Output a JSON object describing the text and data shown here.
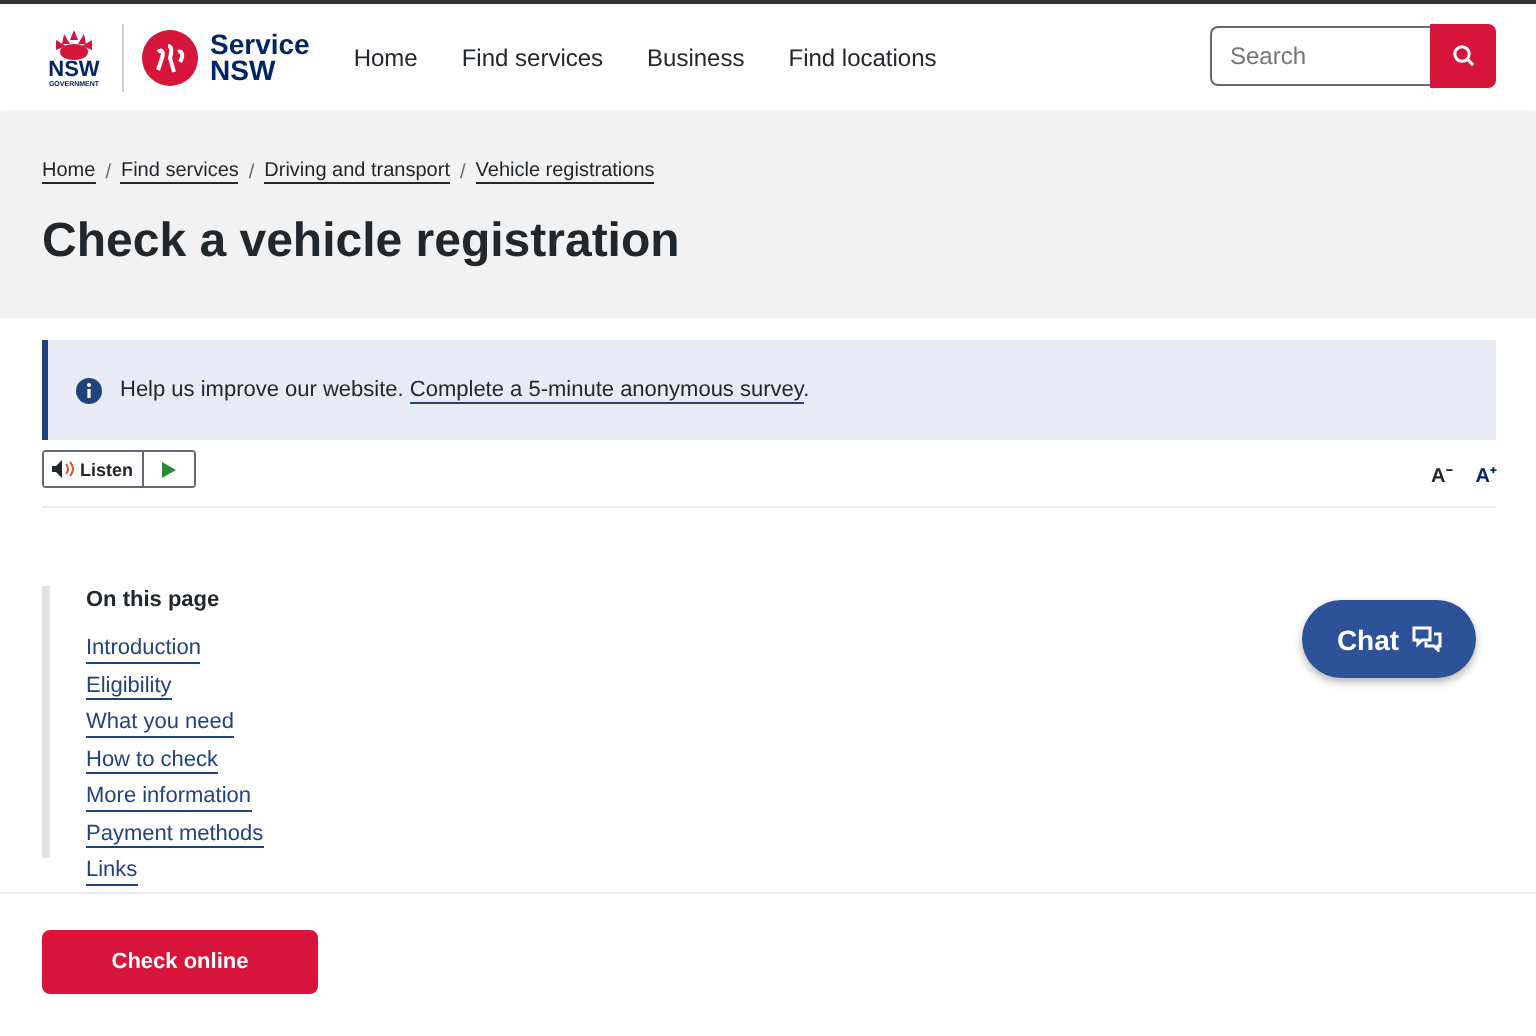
{
  "header": {
    "logo_primary": "NSW",
    "logo_secondary": "GOVERNMENT",
    "brand": [
      "Service",
      "NSW"
    ],
    "nav": [
      {
        "label": "Home"
      },
      {
        "label": "Find services"
      },
      {
        "label": "Business"
      },
      {
        "label": "Find locations"
      }
    ],
    "search": {
      "placeholder": "Search"
    }
  },
  "breadcrumbs": {
    "separator": "/",
    "items": [
      "Home",
      "Find services",
      "Driving and transport",
      "Vehicle registrations"
    ]
  },
  "title": "Check a vehicle registration",
  "banner": {
    "text": "Help us improve our website.",
    "link": "Complete a 5-minute anonymous survey",
    "after": "."
  },
  "listen": {
    "label": "Listen"
  },
  "text_size": [
    {
      "label": "A⁻"
    },
    {
      "label": "A⁺"
    }
  ],
  "toc": {
    "heading": "On this page",
    "items": [
      "Introduction",
      "Eligibility",
      "What you need",
      "How to check",
      "More information",
      "Payment methods",
      "Links"
    ]
  },
  "chat": {
    "label": "Chat"
  },
  "action": {
    "label": "Check online"
  }
}
